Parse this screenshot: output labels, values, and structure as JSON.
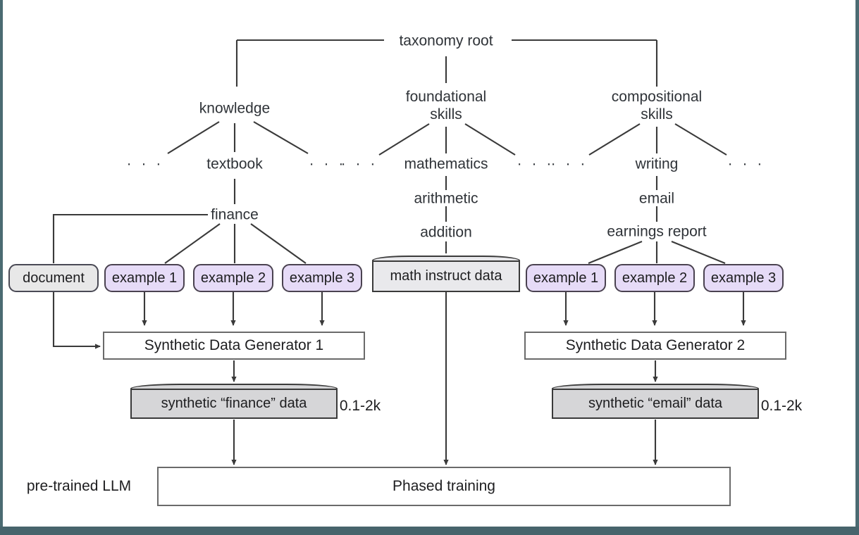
{
  "diagram": {
    "title": "taxonomy-driven synthetic data generation pipeline",
    "colors": {
      "example_fill": "#e6dbf7",
      "document_fill": "#e8e8e8",
      "cylinder_light_fill": "#e9e9ec",
      "cylinder_grey_fill": "#d6d6d8",
      "line": "#3a3a3a",
      "text": "#1d1d1f",
      "frame": "#4b6b72"
    }
  },
  "taxonomy": {
    "root": "taxonomy root",
    "branches": [
      {
        "label": "knowledge",
        "child": "textbook",
        "leaf": "finance"
      },
      {
        "label": "foundational\nskills",
        "child": "mathematics",
        "leaf": "arithmetic",
        "leaf2": "addition"
      },
      {
        "label": "compositional\nskills",
        "child": "writing",
        "leaf": "email",
        "leaf2": "earnings report"
      }
    ],
    "knowledge": "knowledge",
    "textbook": "textbook",
    "finance": "finance",
    "foundational_skills": "foundational\nskills",
    "mathematics": "mathematics",
    "arithmetic": "arithmetic",
    "addition": "addition",
    "compositional_skills": "compositional\nskills",
    "writing": "writing",
    "email": "email",
    "earnings_report": "earnings report",
    "ellipsis": "· · ·"
  },
  "left_pipeline": {
    "document": "document",
    "examples": [
      "example 1",
      "example 2",
      "example 3"
    ],
    "generator": "Synthetic Data Generator 1",
    "output": "synthetic “finance” data",
    "output_count": "0.1-2k"
  },
  "middle_pipeline": {
    "dataset": "math instruct data"
  },
  "right_pipeline": {
    "examples": [
      "example 1",
      "example 2",
      "example 3"
    ],
    "generator": "Synthetic Data Generator 2",
    "output": "synthetic “email” data",
    "output_count": "0.1-2k"
  },
  "training": {
    "model_label": "pre-trained LLM",
    "box": "Phased training"
  }
}
